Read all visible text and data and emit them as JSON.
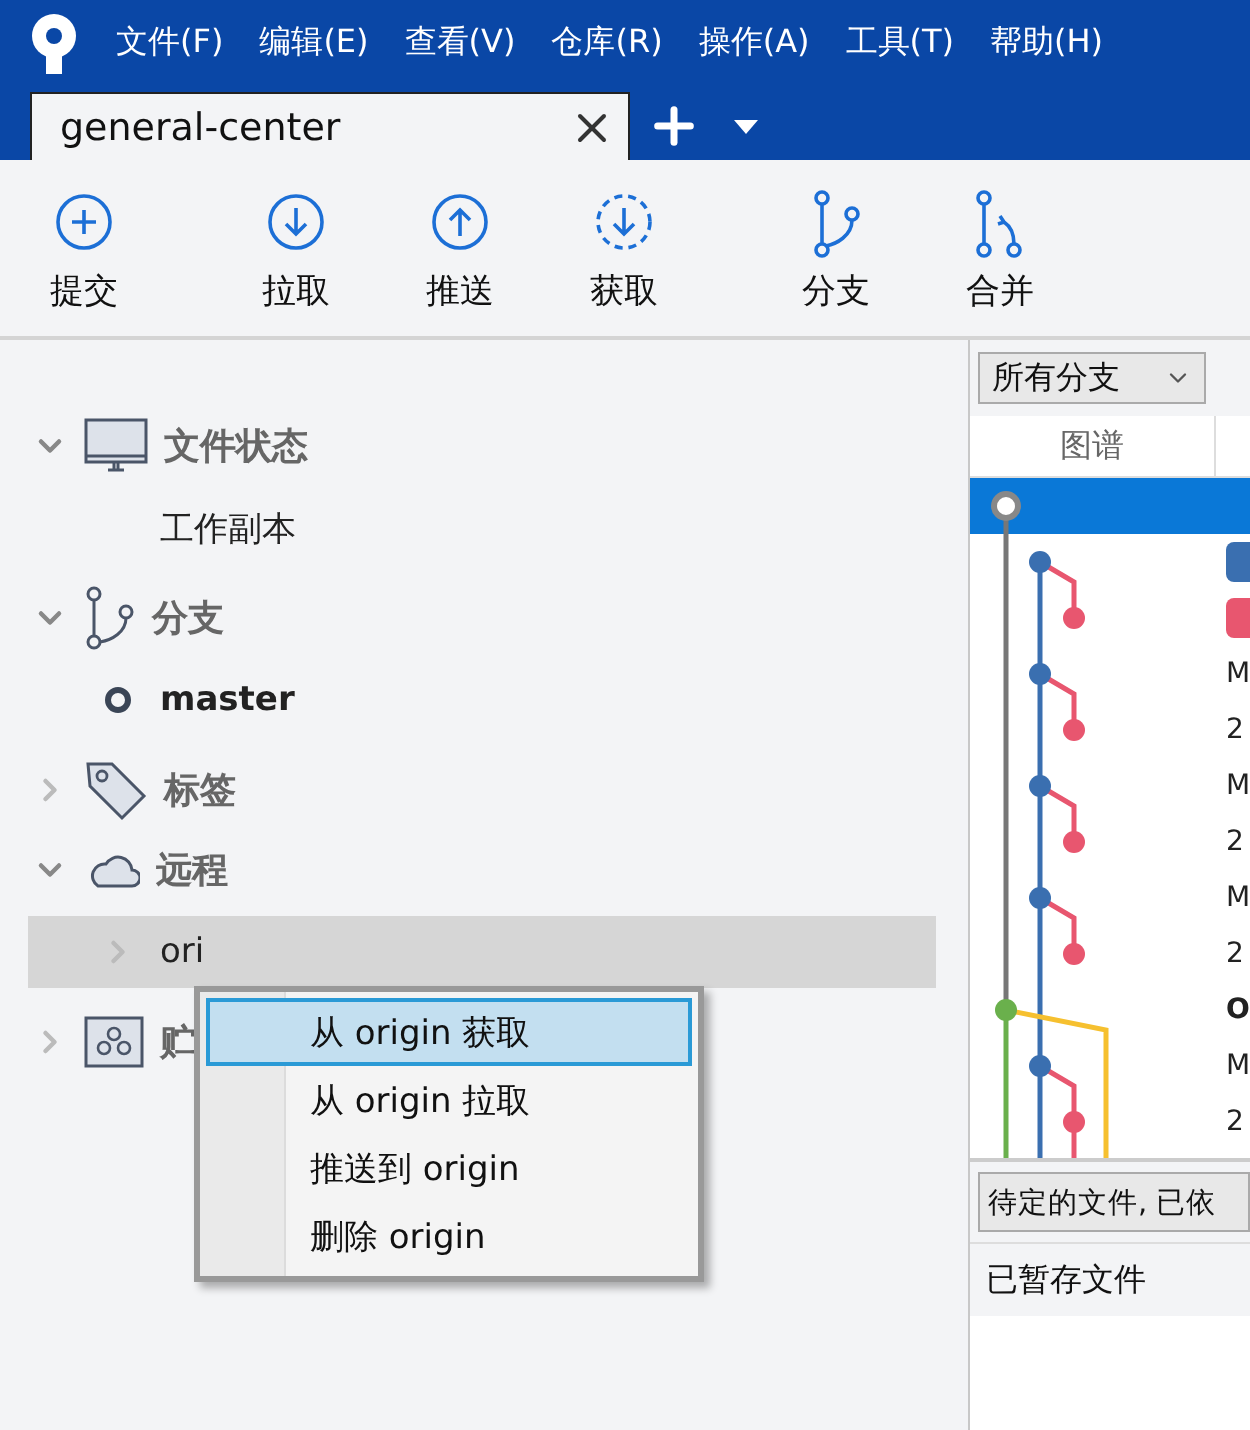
{
  "menu_bar": [
    "文件(F)",
    "编辑(E)",
    "查看(V)",
    "仓库(R)",
    "操作(A)",
    "工具(T)",
    "帮助(H)"
  ],
  "tabs": [
    {
      "label": "general-center",
      "selected": true
    }
  ],
  "toolbar": {
    "groups": [
      [
        {
          "kind": "commit",
          "label": "提交"
        }
      ],
      [
        {
          "kind": "pull",
          "label": "拉取"
        },
        {
          "kind": "push",
          "label": "推送"
        },
        {
          "kind": "fetch",
          "label": "获取"
        }
      ],
      [
        {
          "kind": "branch",
          "label": "分支"
        },
        {
          "kind": "merge",
          "label": "合并"
        }
      ]
    ]
  },
  "sidebar": {
    "sections": [
      {
        "kind": "file-status",
        "label": "文件状态",
        "expanded": true,
        "children": [
          {
            "label": "工作副本",
            "current": false,
            "selected": false
          }
        ]
      },
      {
        "kind": "branches",
        "label": "分支",
        "expanded": true,
        "children": [
          {
            "label": "master",
            "current": true,
            "selected": false
          }
        ]
      },
      {
        "kind": "tags",
        "label": "标签",
        "expanded": false
      },
      {
        "kind": "remotes",
        "label": "远程",
        "expanded": true,
        "children": [
          {
            "label": "ori",
            "current": false,
            "selected": true,
            "expanded": false
          }
        ]
      },
      {
        "kind": "stashes",
        "label": "贮",
        "expanded": false
      }
    ]
  },
  "context_menu": {
    "items": [
      {
        "label": "从 origin 获取",
        "selected": true
      },
      {
        "label": "从 origin 拉取",
        "selected": false
      },
      {
        "label": "推送到 origin",
        "selected": false
      },
      {
        "label": "删除 origin",
        "selected": false
      }
    ]
  },
  "history": {
    "branch_filter": "所有分支",
    "columns": [
      "图谱"
    ],
    "rows": [
      {
        "kind": "plain",
        "selected": true
      },
      {
        "kind": "badge",
        "color": "#3a6fb0",
        "selected": false
      },
      {
        "kind": "badge",
        "color": "#e8566f",
        "selected": false
      },
      {
        "kind": "text",
        "text": "M",
        "bold": false,
        "selected": false
      },
      {
        "kind": "text",
        "text": "2",
        "bold": false,
        "selected": false
      },
      {
        "kind": "text",
        "text": "M",
        "bold": false,
        "selected": false
      },
      {
        "kind": "text",
        "text": "2",
        "bold": false,
        "selected": false
      },
      {
        "kind": "text",
        "text": "M",
        "bold": false,
        "selected": false
      },
      {
        "kind": "text",
        "text": "2",
        "bold": false,
        "selected": false
      },
      {
        "kind": "text",
        "text": "O",
        "bold": true,
        "selected": false
      },
      {
        "kind": "text",
        "text": "M",
        "bold": false,
        "selected": false
      },
      {
        "kind": "text",
        "text": "2",
        "bold": false,
        "selected": false
      }
    ],
    "pending_button": "待定的文件, 已依",
    "staged_label": "已暂存文件"
  }
}
